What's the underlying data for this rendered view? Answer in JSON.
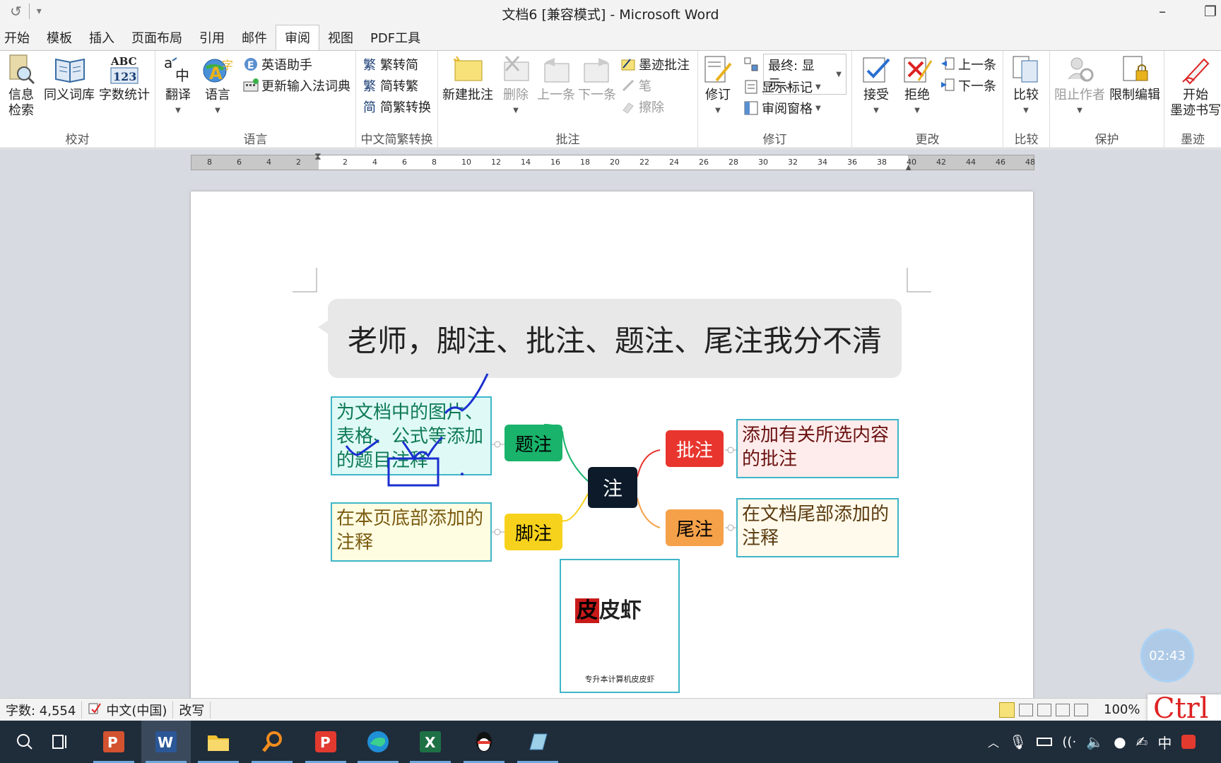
{
  "window": {
    "title": "文档6 [兼容模式] - Microsoft Word",
    "minimize": "–",
    "restore": "❐"
  },
  "qat": {
    "undo_icon": "redo-icon",
    "customize": "▾"
  },
  "tabs": [
    {
      "label": "开始"
    },
    {
      "label": "模板"
    },
    {
      "label": "插入"
    },
    {
      "label": "页面布局"
    },
    {
      "label": "引用"
    },
    {
      "label": "邮件"
    },
    {
      "label": "审阅",
      "active": true
    },
    {
      "label": "视图"
    },
    {
      "label": "PDF工具"
    }
  ],
  "ribbon": {
    "proofing": {
      "label": "校对",
      "research_1": "信息",
      "research_2": "检索",
      "thesaurus": "同义词库",
      "wordcount": "字数统计"
    },
    "language": {
      "label": "语言",
      "translate": "翻译",
      "language": "语言",
      "english_assistant": "英语助手",
      "update_ime": "更新输入法词典"
    },
    "chinese": {
      "label": "中文简繁转换",
      "to_simplified": "繁转简",
      "to_traditional": "简转繁",
      "convert": "简繁转换"
    },
    "comments": {
      "label": "批注",
      "new": "新建批注",
      "delete": "删除",
      "previous": "上一条",
      "next": "下一条",
      "ink": "墨迹批注",
      "pen": "笔",
      "eraser": "擦除"
    },
    "tracking": {
      "label": "修订",
      "track": "修订",
      "display_select": "最终: 显示...",
      "show_markup": "显示标记",
      "review_pane": "审阅窗格"
    },
    "changes": {
      "label": "更改",
      "accept": "接受",
      "reject": "拒绝",
      "previous": "上一条",
      "next": "下一条"
    },
    "compare": {
      "label": "比较",
      "compare": "比较"
    },
    "protect": {
      "label": "保护",
      "block_authors": "阻止作者",
      "restrict": "限制编辑"
    },
    "ink": {
      "label": "墨迹",
      "start_1": "开始",
      "start_2": "墨迹书写"
    }
  },
  "ruler": {
    "left_ticks": [
      "8",
      "6",
      "4",
      "2"
    ],
    "right_ticks": [
      "2",
      "4",
      "6",
      "8",
      "10",
      "12",
      "14",
      "16",
      "18",
      "20",
      "22",
      "24",
      "26",
      "28",
      "30",
      "32",
      "34",
      "36",
      "38",
      "40",
      "42",
      "44",
      "46",
      "48"
    ]
  },
  "document": {
    "question": "老师，脚注、批注、题注、尾注我分不清",
    "center": "注",
    "caption": {
      "tag": "题注",
      "desc": "为文档中的图片、表格、公式等添加的题目注释"
    },
    "footnote": {
      "tag": "脚注",
      "desc": "在本页底部添加的注释"
    },
    "comment": {
      "tag": "批注",
      "desc": "添加有关所选内容的批注"
    },
    "endnote": {
      "tag": "尾注",
      "desc": "在文档尾部添加的注释"
    },
    "logo": {
      "brand_red": "皮",
      "brand_rest": "皮虾",
      "sub": "专升本计算机皮皮虾"
    },
    "colors": {
      "caption": "#19b36b",
      "footnote": "#f7d21c",
      "comment": "#e8352e",
      "endnote": "#f5a14a",
      "border": "#3fb5c9",
      "ink": "#1a2fd0"
    }
  },
  "timer": "02:43",
  "statusbar": {
    "wordcount": "字数: 4,554",
    "language": "中文(中国)",
    "mode": "改写",
    "zoom": "100%"
  },
  "overlay_ctrl": "Ctrl",
  "taskbar": {
    "apps": [
      "search-icon",
      "task-view-icon",
      "powerpoint-icon",
      "word-icon",
      "file-explorer-icon",
      "search-app-icon",
      "pdf-icon",
      "edge-icon",
      "excel-icon",
      "qq-icon",
      "notes-icon"
    ],
    "tray_ime": "中"
  }
}
